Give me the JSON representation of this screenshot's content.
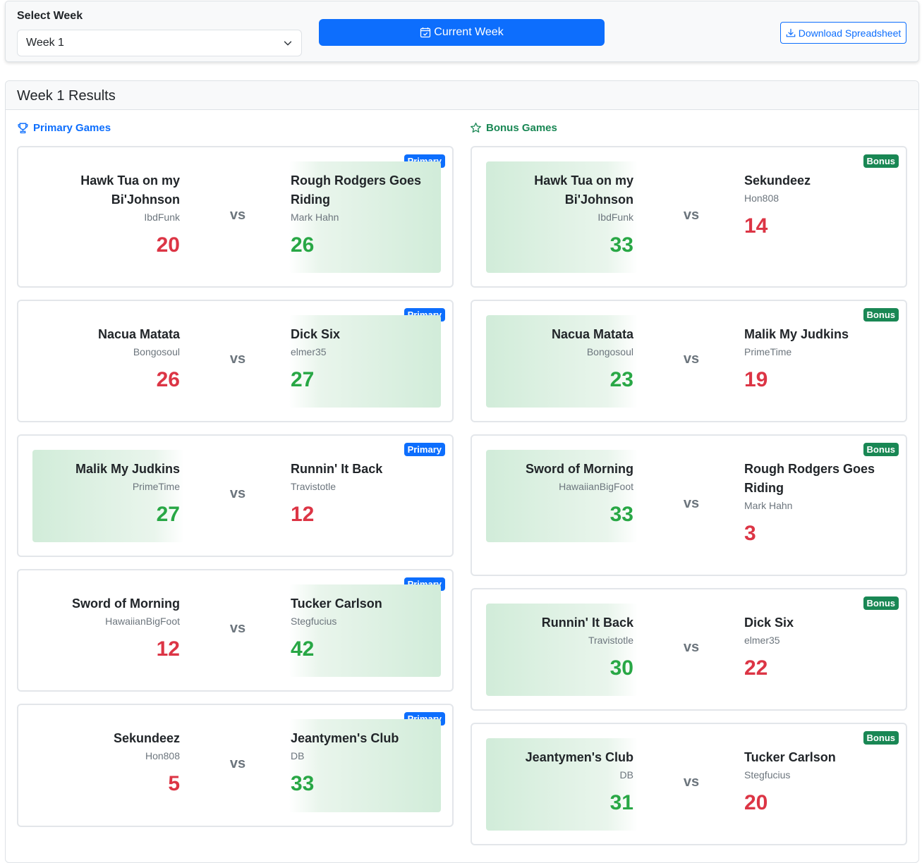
{
  "controls": {
    "select_label": "Select Week",
    "selected_week": "Week 1",
    "current_week_label": "Current Week",
    "download_label": "Download Spreadsheet"
  },
  "results": {
    "title": "Week 1 Results",
    "primary_title": "Primary Games",
    "bonus_title": "Bonus Games",
    "primary_badge": "Primary",
    "bonus_badge": "Bonus",
    "vs_label": "vs"
  },
  "primary_games": [
    {
      "left": {
        "name": "Hawk Tua on my Bi'Johnson",
        "owner": "IbdFunk",
        "score": "20"
      },
      "right": {
        "name": "Rough Rodgers Goes Riding",
        "owner": "Mark Hahn",
        "score": "26"
      }
    },
    {
      "left": {
        "name": "Nacua Matata",
        "owner": "Bongosoul",
        "score": "26"
      },
      "right": {
        "name": "Dick Six",
        "owner": "elmer35",
        "score": "27"
      }
    },
    {
      "left": {
        "name": "Malik My Judkins",
        "owner": "PrimeTime",
        "score": "27"
      },
      "right": {
        "name": "Runnin' It Back",
        "owner": "Travistotle",
        "score": "12"
      }
    },
    {
      "left": {
        "name": "Sword of Morning",
        "owner": "HawaiianBigFoot",
        "score": "12"
      },
      "right": {
        "name": "Tucker Carlson",
        "owner": "Stegfucius",
        "score": "42"
      }
    },
    {
      "left": {
        "name": "Sekundeez",
        "owner": "Hon808",
        "score": "5"
      },
      "right": {
        "name": "Jeantymen's Club",
        "owner": "DB",
        "score": "33"
      }
    }
  ],
  "bonus_games": [
    {
      "left": {
        "name": "Hawk Tua on my Bi'Johnson",
        "owner": "IbdFunk",
        "score": "33"
      },
      "right": {
        "name": "Sekundeez",
        "owner": "Hon808",
        "score": "14"
      }
    },
    {
      "left": {
        "name": "Nacua Matata",
        "owner": "Bongosoul",
        "score": "23"
      },
      "right": {
        "name": "Malik My Judkins",
        "owner": "PrimeTime",
        "score": "19"
      }
    },
    {
      "left": {
        "name": "Sword of Morning",
        "owner": "HawaiianBigFoot",
        "score": "33"
      },
      "right": {
        "name": "Rough Rodgers Goes Riding",
        "owner": "Mark Hahn",
        "score": "3"
      }
    },
    {
      "left": {
        "name": "Runnin' It Back",
        "owner": "Travistotle",
        "score": "30"
      },
      "right": {
        "name": "Dick Six",
        "owner": "elmer35",
        "score": "22"
      }
    },
    {
      "left": {
        "name": "Jeantymen's Club",
        "owner": "DB",
        "score": "31"
      },
      "right": {
        "name": "Tucker Carlson",
        "owner": "Stegfucius",
        "score": "20"
      }
    }
  ],
  "colors": {
    "primary": "#0d6efd",
    "bonus": "#198754",
    "win_score": "#28a745",
    "loss_score": "#dc3545"
  }
}
